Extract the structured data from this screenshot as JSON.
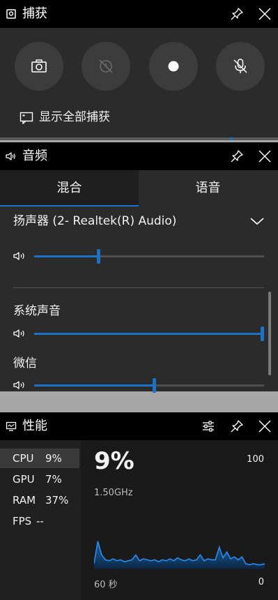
{
  "capture": {
    "title": "捕获",
    "show_all_label": "显示全部捕获"
  },
  "audio": {
    "title": "音频",
    "tabs": [
      "混合",
      "语音"
    ],
    "device_name": "扬声器 (2- Realtek(R) Audio)",
    "apps": [
      {
        "name": "扬声器 (2- Realtek(R) Audio)",
        "volume": 0.28
      },
      {
        "name": "系统声音",
        "volume": 1.0
      },
      {
        "name": "微信",
        "volume": 0.52
      }
    ]
  },
  "performance": {
    "title": "性能",
    "metrics": [
      {
        "name": "CPU",
        "value": "9%"
      },
      {
        "name": "GPU",
        "value": "7%"
      },
      {
        "name": "RAM",
        "value": "37%"
      },
      {
        "name": "FPS",
        "value": "--"
      }
    ],
    "selected_value": "9%",
    "max_label": "100",
    "frequency": "1.50GHz",
    "time_span": "60 秒",
    "min_label": "0",
    "cpu_history": [
      5,
      28,
      14,
      9,
      8,
      10,
      8,
      9,
      7,
      8,
      9,
      14,
      8,
      10,
      9,
      8,
      9,
      7,
      9,
      8,
      10,
      8,
      11,
      9,
      8,
      10,
      8,
      9,
      14,
      8,
      10,
      9,
      9,
      22,
      11,
      17,
      10,
      12,
      9,
      12,
      5,
      4,
      5,
      4,
      4,
      5
    ]
  },
  "colors": {
    "accent": "#1a73c8",
    "panel_bg": "#2b2b2b",
    "titlebar_bg": "#000000"
  }
}
